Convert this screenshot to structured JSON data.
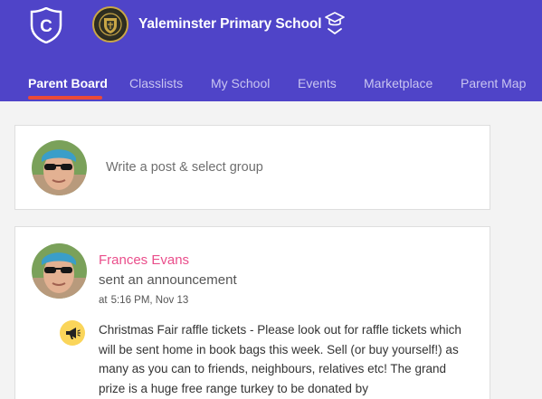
{
  "header": {
    "app_logo_letter": "C",
    "school_name": "Yaleminster Primary School",
    "colors": {
      "header_bg": "#4f44c8",
      "active_underline": "#ea4a37",
      "author_pink": "#ea4e8b",
      "announce_yellow": "#fad55a"
    },
    "icons": {
      "app_logo": "shield-logo-icon",
      "school_switch": "graduation-cap-chevron-icon",
      "school_crest": "school-crest"
    }
  },
  "nav": {
    "items": [
      {
        "label": "Parent Board",
        "active": true
      },
      {
        "label": "Classlists",
        "active": false
      },
      {
        "label": "My School",
        "active": false
      },
      {
        "label": "Events",
        "active": false
      },
      {
        "label": "Marketplace",
        "active": false
      },
      {
        "label": "Parent Map",
        "active": false
      }
    ]
  },
  "composer": {
    "placeholder": "Write a post & select group"
  },
  "post": {
    "author": "Frances Evans",
    "action": "sent an announcement",
    "at_label": "at",
    "time": "5:16 PM, Nov 13",
    "icon": "megaphone-icon",
    "body": "Christmas Fair raffle tickets  -  Please look out for raffle tickets which will be sent home in book bags this week. Sell (or buy yourself!) as many as you can to friends, neighbours, relatives etc! The grand prize is a huge free range turkey to be donated by"
  }
}
